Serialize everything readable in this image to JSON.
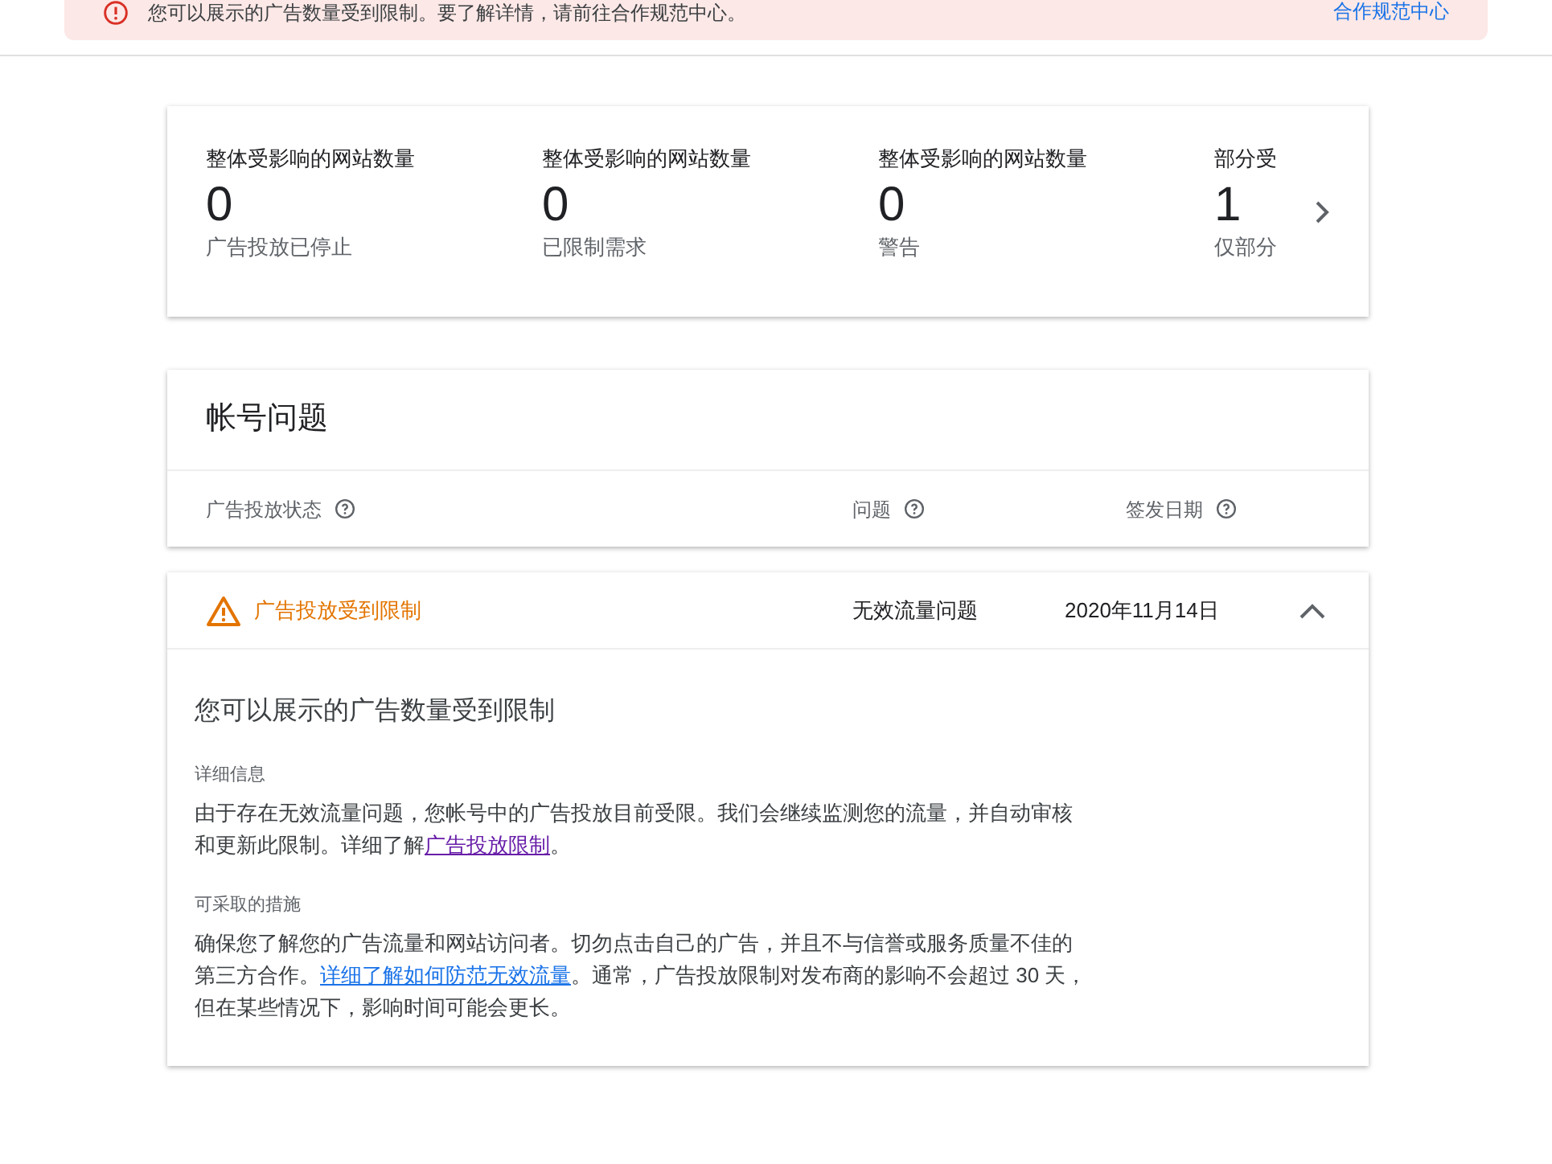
{
  "banner": {
    "message": "您可以展示的广告数量受到限制。要了解详情，请前往合作规范中心。",
    "link": "合作规范中心"
  },
  "summary": [
    {
      "label": "整体受影响的网站数量",
      "value": "0",
      "caption": "广告投放已停止"
    },
    {
      "label": "整体受影响的网站数量",
      "value": "0",
      "caption": "已限制需求"
    },
    {
      "label": "整体受影响的网站数量",
      "value": "0",
      "caption": "警告"
    },
    {
      "label": "部分受",
      "value": "1",
      "caption": "仅部分"
    }
  ],
  "account_issues": {
    "title": "帐号问题",
    "columns": [
      "广告投放状态",
      "问题",
      "签发日期"
    ],
    "rows": [
      {
        "status": "广告投放受到限制",
        "issue": "无效流量问题",
        "date": "2020年11月14日",
        "expanded": true,
        "heading": "您可以展示的广告数量受到限制",
        "sections": [
          {
            "title": "详细信息",
            "before": "由于存在无效流量问题，您帐号中的广告投放目前受限。我们会继续监测您的流量，并自动审核和更新此限制。详细了解",
            "link": "广告投放限制",
            "link_visited": true,
            "after": "。"
          },
          {
            "title": "可采取的措施",
            "before": "确保您了解您的广告流量和网站访问者。切勿点击自己的广告，并且不与信誉或服务质量不佳的第三方合作。",
            "link": "详细了解如何防范无效流量",
            "link_visited": false,
            "after": "。通常，广告投放限制对发布商的影响不会超过 30 天，但在某些情况下，影响时间可能会更长。"
          }
        ]
      }
    ]
  }
}
